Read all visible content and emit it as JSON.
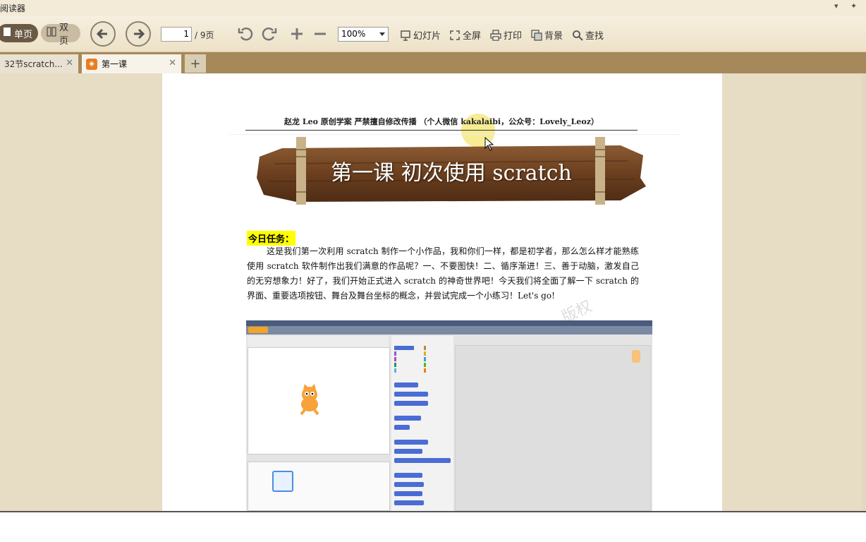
{
  "window": {
    "title": "阅读器",
    "controls": [
      "▾",
      "✦"
    ]
  },
  "toolbar": {
    "single_page": "单页",
    "double_page": "双页",
    "page_current": "1",
    "page_total": "/ 9页",
    "zoom": "100%",
    "slideshow": "幻灯片",
    "fullscreen": "全屏",
    "print": "打印",
    "background": "背景",
    "find": "查找"
  },
  "tabs": [
    {
      "label": "32节scratch...",
      "close": "✕"
    },
    {
      "label": "第一课",
      "close": "✕"
    }
  ],
  "tab_add": "+",
  "document": {
    "header": "赵龙 Leo 原创学案  严禁擅自修改传播   （个人微信 kakalaibi，公众号：Lovely_Leoz）",
    "banner_title": "第一课    初次使用 scratch",
    "task_label": "今日任务：",
    "paragraph": "这是我们第一次利用 scratch 制作一个小作品，我和你们一样，都是初学者，那么怎么样才能熟练使用 scratch 软件制作出我们满意的作品呢？一、不要图快！二、循序渐进！三、善于动脑，激发自己的无穷想象力！好了，我们开始正式进入 scratch 的神奇世界吧！今天我们将全面了解一下 scratch 的界面、重要选项按钮、舞台及舞台坐标的概念，并尝试完成一个小练习！Let's go!",
    "watermark": "版权"
  },
  "colors": {
    "toolbar_bg": "#f0e6cf",
    "tabbar_bg": "#a6895a",
    "content_bg": "#e7dcc4",
    "highlight": "#ffff00"
  }
}
